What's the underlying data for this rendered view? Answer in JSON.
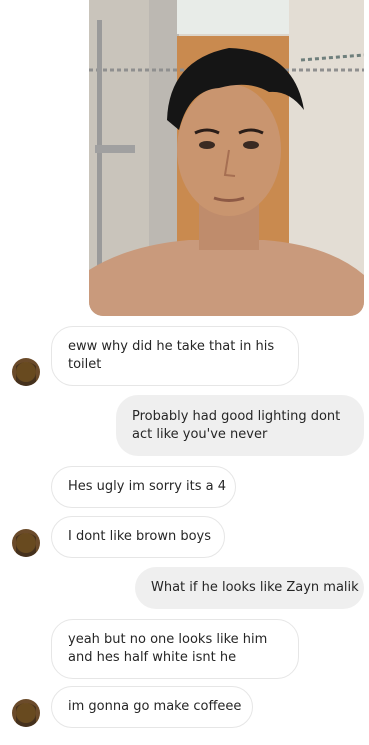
{
  "photo": {
    "icon": "shared-photo-selfie"
  },
  "messages": [
    {
      "side": "received",
      "text_line1": "eww why did he take that in his",
      "text_line2": "toilet"
    },
    {
      "side": "sent",
      "text_line1": "Probably had good lighting dont",
      "text_line2": "act like you've never"
    },
    {
      "side": "received",
      "text": "Hes ugly im sorry its a 4"
    },
    {
      "side": "received",
      "text": "I dont like brown boys"
    },
    {
      "side": "sent",
      "text": "What if he looks like Zayn malik"
    },
    {
      "side": "received",
      "text_line1": "yeah but no one looks like him",
      "text_line2": "and hes half white isnt he"
    },
    {
      "side": "received",
      "text": "im gonna go make coffeee"
    }
  ],
  "colors": {
    "sent_bubble": "#efefef",
    "received_border": "#e6e6e6",
    "text": "#262626"
  }
}
